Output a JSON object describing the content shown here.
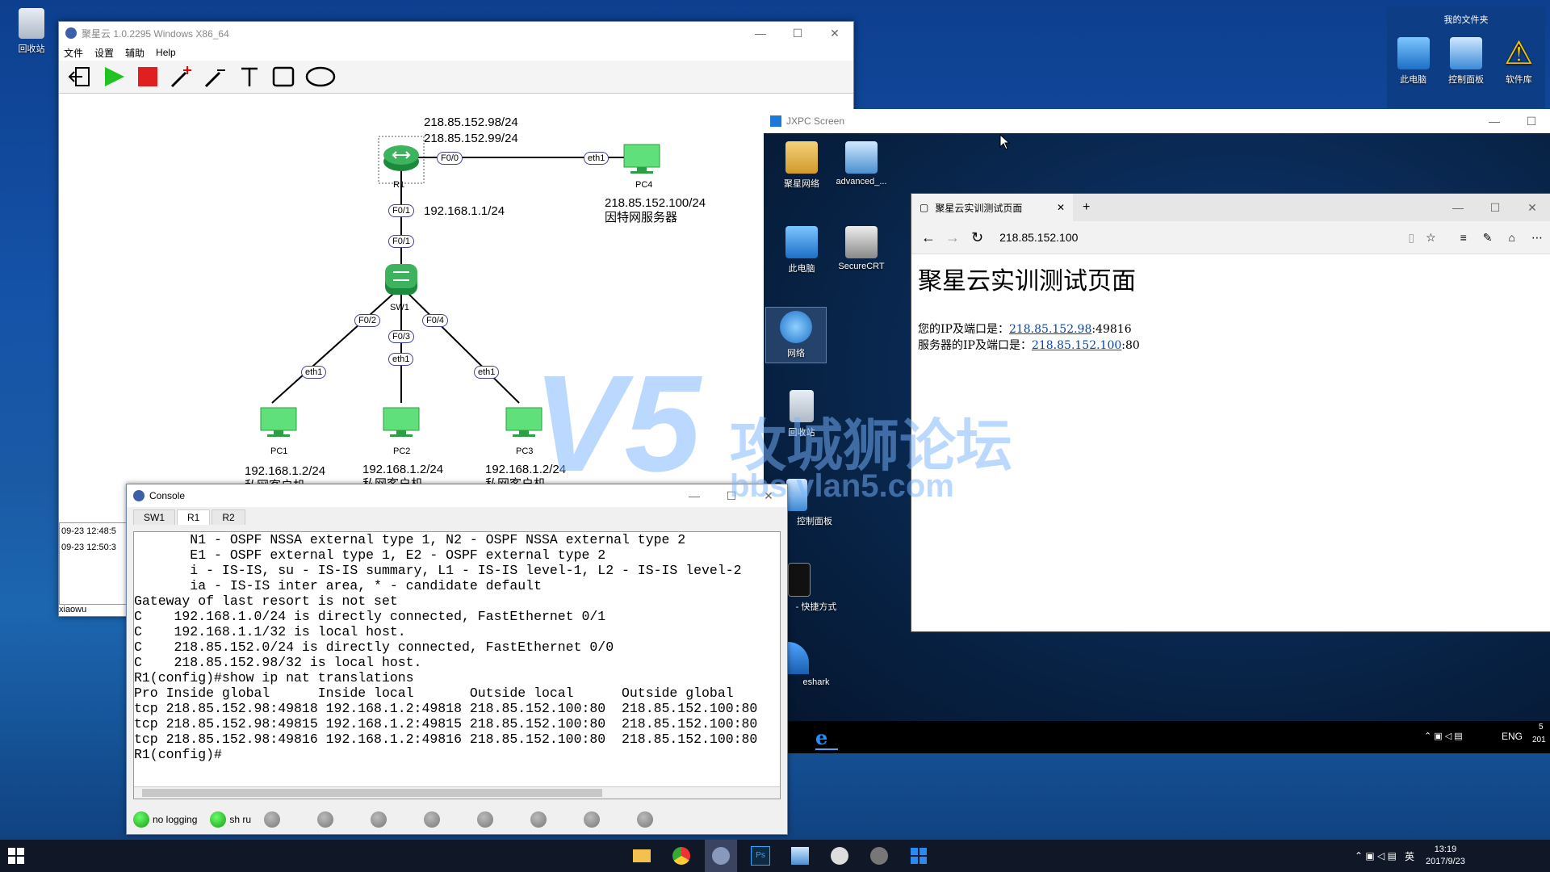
{
  "desktop": {
    "recycle_bin": "回收站",
    "my_folder": "我的文件夹",
    "right_icons": [
      "此电脑",
      "控制面板",
      "软件库"
    ]
  },
  "app": {
    "title": "聚星云 1.0.2295  Windows  X86_64",
    "menu": [
      "文件",
      "设置",
      "辅助",
      "Help"
    ],
    "topology": {
      "r1_ip_a": "218.85.152.98/24",
      "r1_ip_b": "218.85.152.99/24",
      "r1": "R1",
      "pc4": "PC4",
      "pc4_ip": "218.85.152.100/24",
      "pc4_desc": "因特网服务器",
      "r1_lan_ip": "192.168.1.1/24",
      "sw1": "SW1",
      "pc1": "PC1",
      "pc2": "PC2",
      "pc3": "PC3",
      "pc1_ip": "192.168.1.2/24",
      "pc2_ip": "192.168.1.2/24",
      "pc3_ip": "192.168.1.2/24",
      "pc_desc": "私网客户机",
      "ports": {
        "r1_f00": "F0/0",
        "pc4_eth1": "eth1",
        "r1_f01": "F0/1",
        "sw1_f01": "F0/1",
        "sw1_f02": "F0/2",
        "sw1_f03": "F0/3",
        "sw1_f04": "F0/4",
        "pc1_eth1": "eth1",
        "pc2_eth1": "eth1",
        "pc3_eth1": "eth1"
      }
    },
    "log": [
      "09-23 12:48:5",
      "09-23 12:50:3"
    ],
    "user": "xiaowu"
  },
  "console": {
    "title": "Console",
    "tabs": [
      "SW1",
      "R1",
      "R2"
    ],
    "lines": [
      "       N1 - OSPF NSSA external type 1, N2 - OSPF NSSA external type 2",
      "       E1 - OSPF external type 1, E2 - OSPF external type 2",
      "       i - IS-IS, su - IS-IS summary, L1 - IS-IS level-1, L2 - IS-IS level-2",
      "       ia - IS-IS inter area, * - candidate default",
      "",
      "Gateway of last resort is not set",
      "C    192.168.1.0/24 is directly connected, FastEthernet 0/1",
      "C    192.168.1.1/32 is local host.",
      "C    218.85.152.0/24 is directly connected, FastEthernet 0/0",
      "C    218.85.152.98/32 is local host.",
      "R1(config)#show ip nat translations",
      "Pro Inside global      Inside local       Outside local      Outside global",
      "tcp 218.85.152.98:49818 192.168.1.2:49818 218.85.152.100:80  218.85.152.100:80",
      "tcp 218.85.152.98:49815 192.168.1.2:49815 218.85.152.100:80  218.85.152.100:80",
      "tcp 218.85.152.98:49816 192.168.1.2:49816 218.85.152.100:80  218.85.152.100:80",
      "R1(config)#"
    ],
    "footer": [
      "no logging",
      "sh ru"
    ]
  },
  "jxpc": {
    "title": "JXPC Screen",
    "icons": [
      "聚星网络",
      "advanced_...",
      "此电脑",
      "SecureCRT",
      "网络",
      "回收站",
      "控制面板",
      "- 快捷方式",
      "eshark"
    ],
    "taskbar_lang": "ENG",
    "taskbar_clock": "5",
    "taskbar_year": "201"
  },
  "browser": {
    "tab_title": "聚星云实训测试页面",
    "url": "218.85.152.100",
    "heading": "聚星云实训测试页面",
    "client_label": "您的IP及端口是：",
    "client_ip": "218.85.152.98",
    "client_port": ":49816",
    "server_label": "服务器的IP及端口是：",
    "server_ip": "218.85.152.100",
    "server_port": ":80"
  },
  "watermark": {
    "cn": "攻城狮论坛",
    "url": "bbs.vlan5.com"
  },
  "taskbar": {
    "time": "13:19",
    "date": "2017/9/23",
    "ime": "英"
  }
}
